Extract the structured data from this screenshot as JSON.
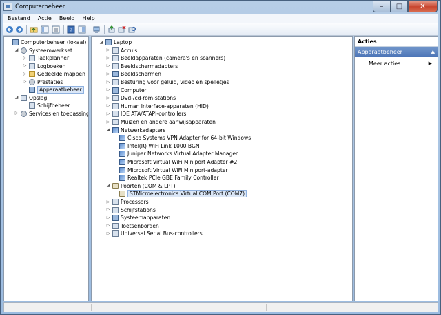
{
  "window": {
    "title": "Computerbeheer"
  },
  "menu": [
    {
      "pre": "",
      "u": "B",
      "post": "estand"
    },
    {
      "pre": "",
      "u": "A",
      "post": "ctie"
    },
    {
      "pre": "Bee",
      "u": "l",
      "post": "d"
    },
    {
      "pre": "",
      "u": "H",
      "post": "elp"
    }
  ],
  "left_tree": [
    {
      "label": "Computerbeheer (lokaal)",
      "level": 0,
      "exp": "",
      "icon": "computer-management-icon",
      "cls": "pc"
    },
    {
      "label": "Systeemwerkset",
      "level": 1,
      "exp": "◢",
      "icon": "tools-icon",
      "cls": "gear"
    },
    {
      "label": "Taakplanner",
      "level": 2,
      "exp": "▷",
      "icon": "clock-icon",
      "cls": ""
    },
    {
      "label": "Logboeken",
      "level": 2,
      "exp": "▷",
      "icon": "event-viewer-icon",
      "cls": ""
    },
    {
      "label": "Gedeelde mappen",
      "level": 2,
      "exp": "▷",
      "icon": "shared-folder-icon",
      "cls": "folder"
    },
    {
      "label": "Prestaties",
      "level": 2,
      "exp": "▷",
      "icon": "performance-icon",
      "cls": "gear"
    },
    {
      "label": "Apparaatbeheer",
      "level": 2,
      "exp": "",
      "icon": "device-manager-icon",
      "cls": "pc",
      "selected": true
    },
    {
      "label": "Opslag",
      "level": 1,
      "exp": "◢",
      "icon": "storage-icon",
      "cls": ""
    },
    {
      "label": "Schijfbeheer",
      "level": 2,
      "exp": "",
      "icon": "disk-management-icon",
      "cls": ""
    },
    {
      "label": "Services en toepassingen",
      "level": 1,
      "exp": "▷",
      "icon": "services-icon",
      "cls": "gear"
    }
  ],
  "device_tree": [
    {
      "label": "Laptop",
      "level": 0,
      "exp": "◢",
      "icon": "laptop-icon",
      "cls": "pc"
    },
    {
      "label": "Accu's",
      "level": 1,
      "exp": "▷",
      "icon": "battery-icon",
      "cls": ""
    },
    {
      "label": "Beeldapparaten (camera's en scanners)",
      "level": 1,
      "exp": "▷",
      "icon": "camera-icon",
      "cls": ""
    },
    {
      "label": "Beeldschermadapters",
      "level": 1,
      "exp": "▷",
      "icon": "display-adapter-icon",
      "cls": ""
    },
    {
      "label": "Beeldschermen",
      "level": 1,
      "exp": "▷",
      "icon": "monitor-icon",
      "cls": "pc"
    },
    {
      "label": "Besturing voor geluid, video en spelletjes",
      "level": 1,
      "exp": "▷",
      "icon": "speaker-icon",
      "cls": ""
    },
    {
      "label": "Computer",
      "level": 1,
      "exp": "▷",
      "icon": "computer-icon",
      "cls": "pc"
    },
    {
      "label": "Dvd-/cd-rom-stations",
      "level": 1,
      "exp": "▷",
      "icon": "dvd-drive-icon",
      "cls": ""
    },
    {
      "label": "Human Interface-apparaten (HID)",
      "level": 1,
      "exp": "▷",
      "icon": "hid-icon",
      "cls": ""
    },
    {
      "label": "IDE ATA/ATAPI-controllers",
      "level": 1,
      "exp": "▷",
      "icon": "ide-controller-icon",
      "cls": ""
    },
    {
      "label": "Muizen en andere aanwijsapparaten",
      "level": 1,
      "exp": "▷",
      "icon": "mouse-icon",
      "cls": ""
    },
    {
      "label": "Netwerkadapters",
      "level": 1,
      "exp": "◢",
      "icon": "network-adapter-icon",
      "cls": "net"
    },
    {
      "label": "Cisco Systems VPN Adapter for 64-bit Windows",
      "level": 2,
      "exp": "",
      "icon": "network-adapter-icon",
      "cls": "net"
    },
    {
      "label": "Intel(R) WiFi Link 1000 BGN",
      "level": 2,
      "exp": "",
      "icon": "network-adapter-icon",
      "cls": "net"
    },
    {
      "label": "Juniper Networks Virtual Adapter Manager",
      "level": 2,
      "exp": "",
      "icon": "network-adapter-icon",
      "cls": "net"
    },
    {
      "label": "Microsoft Virtual WiFi Miniport Adapter #2",
      "level": 2,
      "exp": "",
      "icon": "network-adapter-icon",
      "cls": "net"
    },
    {
      "label": "Microsoft Virtual WiFi Miniport-adapter",
      "level": 2,
      "exp": "",
      "icon": "network-adapter-icon",
      "cls": "net"
    },
    {
      "label": "Realtek PCIe GBE Family Controller",
      "level": 2,
      "exp": "",
      "icon": "network-adapter-icon",
      "cls": "net"
    },
    {
      "label": "Poorten (COM & LPT)",
      "level": 1,
      "exp": "◢",
      "icon": "port-icon",
      "cls": "port"
    },
    {
      "label": "STMicroelectronics Virtual COM Port (COM7)",
      "level": 2,
      "exp": "",
      "icon": "port-icon",
      "cls": "port",
      "selected": true
    },
    {
      "label": "Processors",
      "level": 1,
      "exp": "▷",
      "icon": "processor-icon",
      "cls": ""
    },
    {
      "label": "Schijfstations",
      "level": 1,
      "exp": "▷",
      "icon": "disk-drive-icon",
      "cls": ""
    },
    {
      "label": "Systeemapparaten",
      "level": 1,
      "exp": "▷",
      "icon": "system-device-icon",
      "cls": "pc"
    },
    {
      "label": "Toetsenborden",
      "level": 1,
      "exp": "▷",
      "icon": "keyboard-icon",
      "cls": ""
    },
    {
      "label": "Universal Serial Bus-controllers",
      "level": 1,
      "exp": "▷",
      "icon": "usb-icon",
      "cls": ""
    }
  ],
  "actions": {
    "header": "Acties",
    "section": "Apparaatbeheer",
    "more": "Meer acties"
  }
}
